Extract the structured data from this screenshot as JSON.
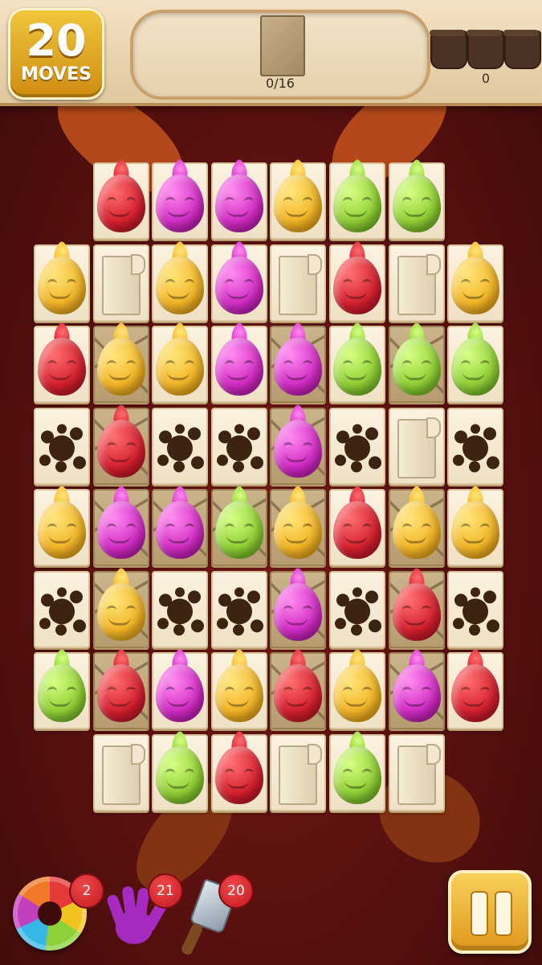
{
  "hud": {
    "moves_count": "20",
    "moves_label": "MOVES",
    "goal_progress": "0/16",
    "goal_icon": "cracked-tile-icon",
    "pots_count": "0",
    "pots_icon": "chocolate-pot-icon"
  },
  "board": {
    "rows": [
      {
        "start_col": 1,
        "cells": [
          [
            "red",
            "plain"
          ],
          [
            "pink",
            "plain"
          ],
          [
            "pink",
            "plain"
          ],
          [
            "yellow",
            "plain"
          ],
          [
            "green",
            "plain"
          ],
          [
            "green",
            "plain"
          ]
        ]
      },
      {
        "start_col": 0,
        "cells": [
          [
            "yellow",
            "plain"
          ],
          [
            "scroll",
            "plain"
          ],
          [
            "yellow",
            "plain"
          ],
          [
            "pink",
            "plain"
          ],
          [
            "scroll",
            "plain"
          ],
          [
            "red",
            "plain"
          ],
          [
            "scroll",
            "plain"
          ],
          [
            "yellow",
            "plain"
          ]
        ]
      },
      {
        "start_col": 0,
        "cells": [
          [
            "red",
            "plain"
          ],
          [
            "yellow",
            "cracked"
          ],
          [
            "yellow",
            "plain"
          ],
          [
            "pink",
            "plain"
          ],
          [
            "pink",
            "cracked"
          ],
          [
            "green",
            "plain"
          ],
          [
            "green",
            "cracked"
          ],
          [
            "green",
            "plain"
          ]
        ]
      },
      {
        "start_col": 0,
        "cells": [
          [
            "splat",
            "plain"
          ],
          [
            "red",
            "cracked"
          ],
          [
            "splat",
            "plain"
          ],
          [
            "splat",
            "plain"
          ],
          [
            "pink",
            "cracked"
          ],
          [
            "splat",
            "plain"
          ],
          [
            "scroll",
            "plain"
          ],
          [
            "splat",
            "plain"
          ]
        ]
      },
      {
        "start_col": 0,
        "cells": [
          [
            "yellow",
            "plain"
          ],
          [
            "pink",
            "cracked"
          ],
          [
            "pink",
            "cracked"
          ],
          [
            "green",
            "cracked"
          ],
          [
            "yellow",
            "cracked"
          ],
          [
            "red",
            "plain"
          ],
          [
            "yellow",
            "cracked"
          ],
          [
            "yellow",
            "plain"
          ]
        ]
      },
      {
        "start_col": 0,
        "cells": [
          [
            "splat",
            "plain"
          ],
          [
            "yellow",
            "cracked"
          ],
          [
            "splat",
            "plain"
          ],
          [
            "splat",
            "plain"
          ],
          [
            "pink",
            "cracked"
          ],
          [
            "splat",
            "plain"
          ],
          [
            "red",
            "cracked"
          ],
          [
            "splat",
            "plain"
          ]
        ]
      },
      {
        "start_col": 0,
        "cells": [
          [
            "green",
            "plain"
          ],
          [
            "red",
            "cracked"
          ],
          [
            "pink",
            "plain"
          ],
          [
            "yellow",
            "plain"
          ],
          [
            "red",
            "cracked"
          ],
          [
            "yellow",
            "plain"
          ],
          [
            "pink",
            "cracked"
          ],
          [
            "red",
            "plain"
          ]
        ]
      },
      {
        "start_col": 1,
        "cells": [
          [
            "scroll",
            "plain"
          ],
          [
            "green",
            "plain"
          ],
          [
            "red",
            "plain"
          ],
          [
            "scroll",
            "plain"
          ],
          [
            "green",
            "plain"
          ],
          [
            "scroll",
            "plain"
          ]
        ]
      }
    ]
  },
  "boosters": [
    {
      "name": "rainbow-donut-icon",
      "count": "2"
    },
    {
      "name": "paint-hand-icon",
      "count": "21"
    },
    {
      "name": "scraper-icon",
      "count": "20"
    }
  ],
  "colors": {
    "red": "#d51f2e",
    "pink": "#d22bc4",
    "yellow": "#f2b425",
    "green": "#8fcf34",
    "accent_gold": "#e0981c"
  }
}
